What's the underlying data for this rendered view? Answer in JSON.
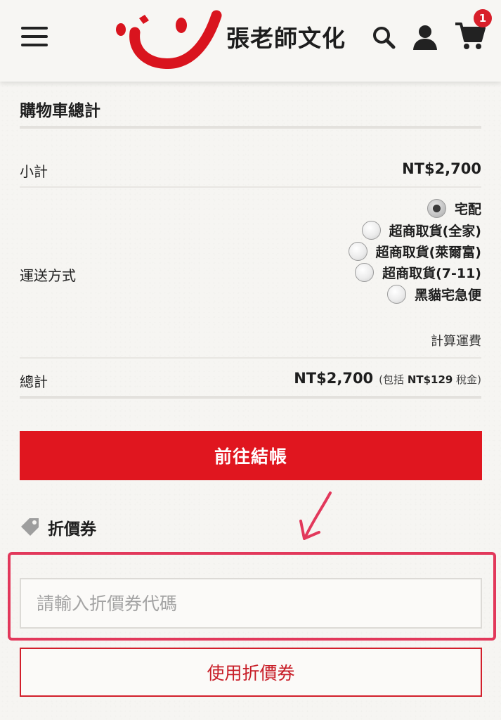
{
  "header": {
    "brand_name": "張老師文化",
    "cart_count": "1",
    "accent_color": "#e0161f"
  },
  "cart_totals": {
    "title": "購物車總計",
    "subtotal_label": "小計",
    "subtotal_value": "NT$2,700",
    "shipping_label": "運送方式",
    "shipping_options": [
      {
        "label": "宅配",
        "selected": true
      },
      {
        "label": "超商取貨(全家)",
        "selected": false
      },
      {
        "label": "超商取貨(萊爾富)",
        "selected": false
      },
      {
        "label": "超商取貨(7-11)",
        "selected": false
      },
      {
        "label": "黑貓宅急便",
        "selected": false
      }
    ],
    "calculate_shipping": "計算運費",
    "total_label": "總計",
    "total_value": "NT$2,700",
    "tax_prefix": "(包括",
    "tax_amount": "NT$129",
    "tax_suffix": "稅金)",
    "checkout_label": "前往結帳"
  },
  "coupon": {
    "title": "折價券",
    "placeholder": "請輸入折價券代碼",
    "value": "",
    "apply_label": "使用折價券"
  }
}
